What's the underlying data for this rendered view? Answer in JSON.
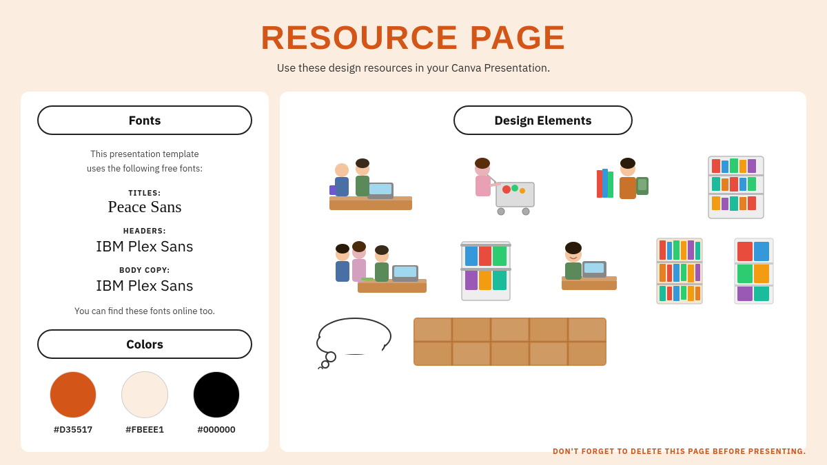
{
  "page": {
    "title": "RESOURCE PAGE",
    "subtitle": "Use these design resources in your Canva Presentation.",
    "background_color": "#FBEEE1",
    "footer_note": "DON'T FORGET TO DELETE THIS PAGE BEFORE PRESENTING."
  },
  "fonts_section": {
    "header": "Fonts",
    "description": "This presentation template\nuses the following free fonts:",
    "entries": [
      {
        "label": "TITLES:",
        "name": "Peace Sans",
        "style": "title"
      },
      {
        "label": "HEADERS:",
        "name": "IBM Plex Sans",
        "style": "body"
      },
      {
        "label": "BODY COPY:",
        "name": "IBM Plex Sans",
        "style": "body"
      }
    ],
    "footer_note": "You can find these fonts online too."
  },
  "colors_section": {
    "header": "Colors",
    "swatches": [
      {
        "hex": "#D35517",
        "label": "#D35517"
      },
      {
        "hex": "#FBEEE1",
        "label": "#FBEEE1"
      },
      {
        "hex": "#000000",
        "label": "#000000"
      }
    ]
  },
  "design_elements": {
    "header": "Design Elements"
  }
}
